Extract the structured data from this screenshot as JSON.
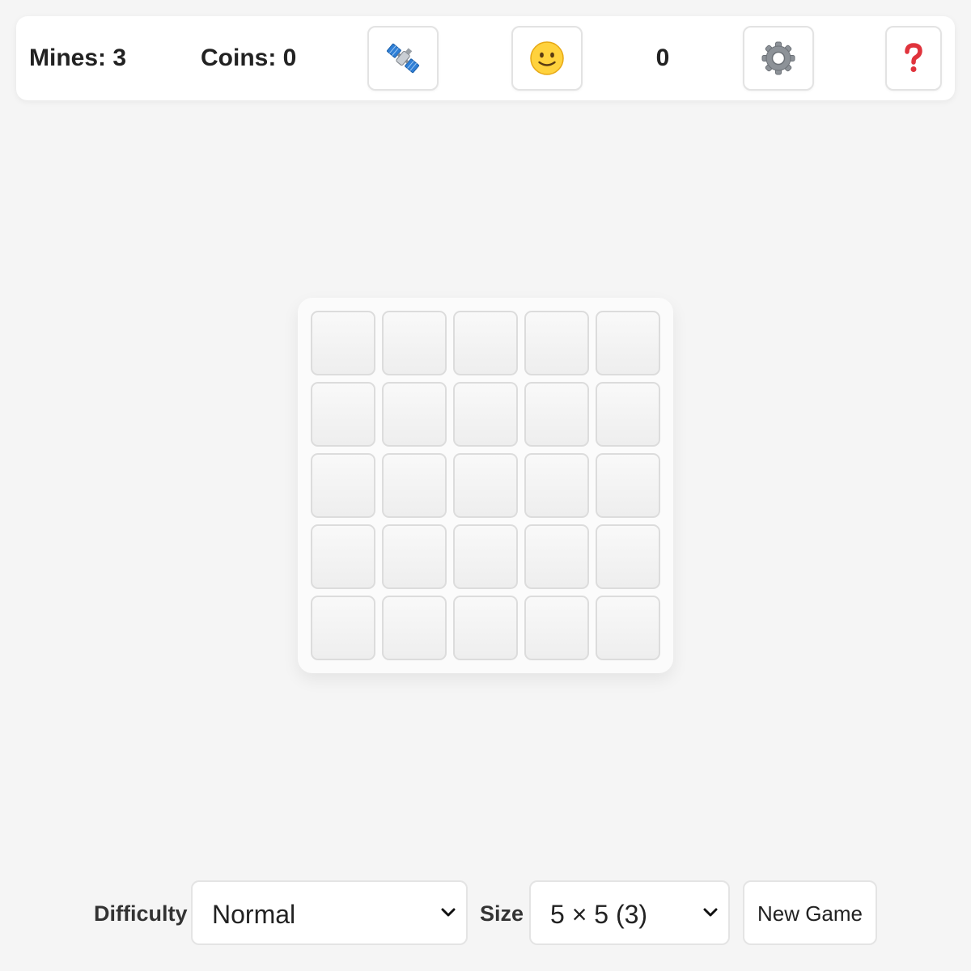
{
  "topbar": {
    "mines_label": "Mines: 3",
    "coins_label": "Coins: 0",
    "satellite_button_icon": "satellite-icon",
    "face_button_icon": "smiley-face-icon",
    "timer_value": "0",
    "settings_button_icon": "gear-icon",
    "help_button_icon": "question-mark-icon",
    "help_color": "#e0333c"
  },
  "board": {
    "rows": 5,
    "cols": 5,
    "cells_state": "unrevealed"
  },
  "controls": {
    "difficulty_label": "Difficulty",
    "difficulty_value": "Normal",
    "size_label": "Size",
    "size_value": "5 × 5 (3)",
    "new_game_label": "New Game"
  }
}
